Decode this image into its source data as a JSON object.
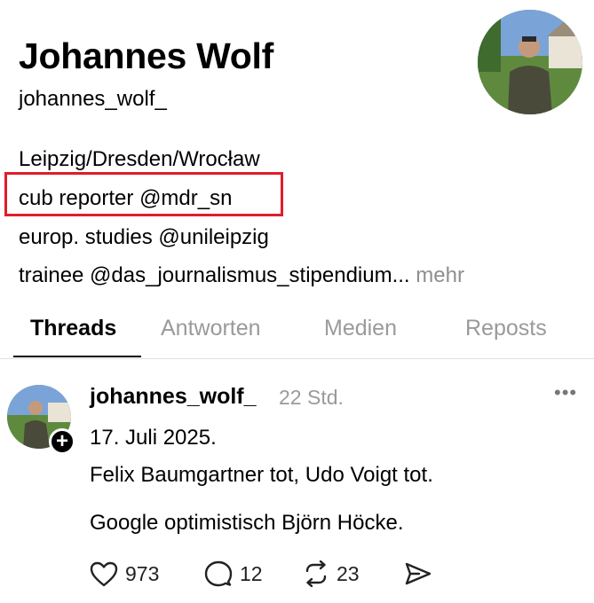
{
  "profile": {
    "name": "Johannes Wolf",
    "handle": "johannes_wolf_",
    "bio": {
      "line1": "Leipzig/Dresden/Wrocław",
      "line2": "cub reporter @mdr_sn",
      "line3": "europ. studies @unileipzig",
      "line4": "trainee @das_journalismus_stipendium...",
      "more": "mehr"
    },
    "highlight_color": "#e11d2a"
  },
  "tabs": {
    "threads": "Threads",
    "replies": "Antworten",
    "media": "Medien",
    "reposts": "Reposts",
    "active": "threads"
  },
  "post": {
    "username": "johannes_wolf_",
    "time": "22 Std.",
    "more_icon": "ellipsis-icon",
    "lines": {
      "l1": "17. Juli 2025.",
      "l2": "Felix Baumgartner tot, Udo Voigt tot.",
      "l3": "Google optimistisch Björn Höcke."
    },
    "likes": "973",
    "comments": "12",
    "reposts": "23",
    "icons": [
      "heart-icon",
      "comment-icon",
      "repost-icon",
      "share-icon"
    ]
  }
}
